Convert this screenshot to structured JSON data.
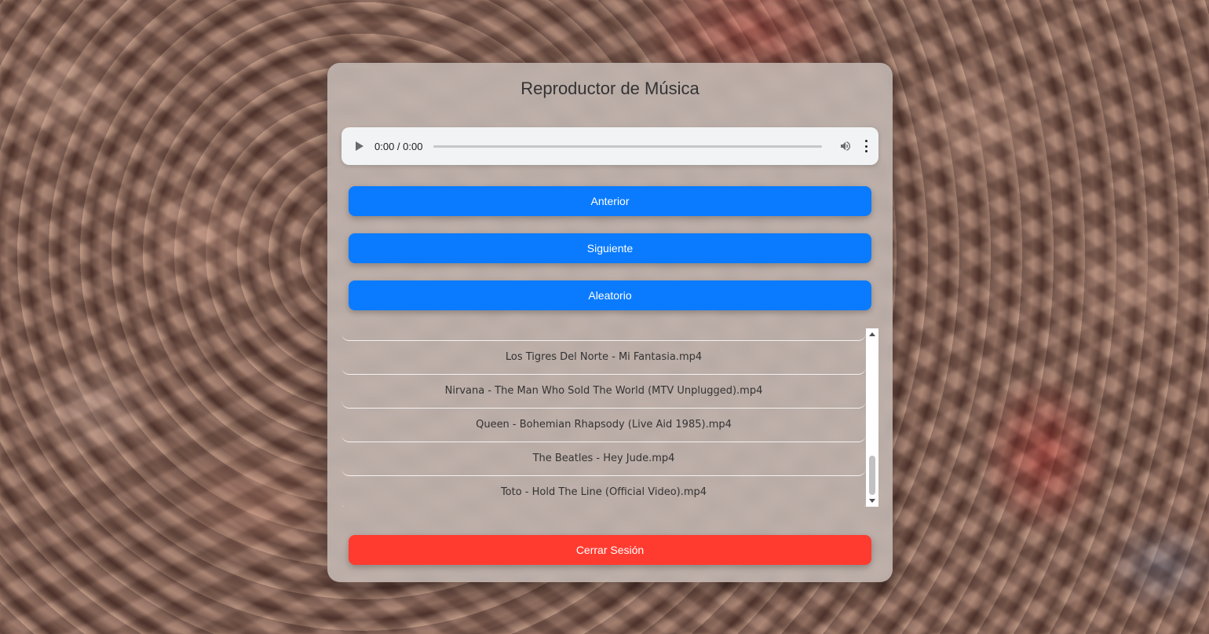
{
  "player": {
    "title": "Reproductor de Música",
    "audio": {
      "time": "0:00 / 0:00",
      "progress": 0
    },
    "buttons": {
      "previous": "Anterior",
      "next": "Siguiente",
      "shuffle": "Aleatorio",
      "logout": "Cerrar Sesión"
    },
    "playlist": [
      "",
      "Los Tigres Del Norte - Mi Fantasia.mp4",
      "Nirvana - The Man Who Sold The World (MTV Unplugged).mp4",
      "Queen - Bohemian Rhapsody (Live Aid 1985).mp4",
      "The Beatles - Hey Jude.mp4",
      "Toto - Hold The Line (Official Video).mp4"
    ]
  },
  "colors": {
    "primary_button": "#0a7bff",
    "logout_button": "#ff3b30",
    "audio_bg": "#f1f3f4"
  },
  "icons": {
    "play": "play-icon",
    "volume": "volume-icon",
    "more": "more-vertical-icon"
  }
}
